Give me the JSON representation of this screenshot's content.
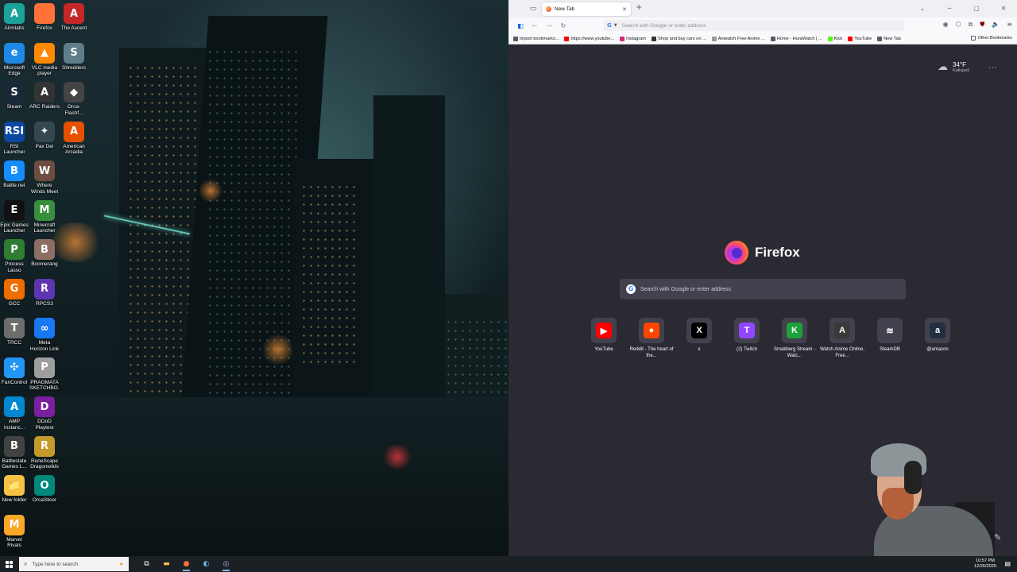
{
  "desktop": {
    "icons": [
      {
        "label": "Airmlabs",
        "glyph": "A",
        "color": "#1aa39a"
      },
      {
        "label": "Firefox",
        "glyph": "",
        "color": "#ff7139"
      },
      {
        "label": "The Ascent",
        "glyph": "A",
        "color": "#c62828"
      },
      {
        "label": "Microsoft Edge",
        "glyph": "e",
        "color": "#1e88e5"
      },
      {
        "label": "VLC media player",
        "glyph": "▲",
        "color": "#ff8800"
      },
      {
        "label": "Shredders",
        "glyph": "S",
        "color": "#607d8b"
      },
      {
        "label": "Steam",
        "glyph": "S",
        "color": "#1b2838"
      },
      {
        "label": "ARC Raiders",
        "glyph": "A",
        "color": "#333333"
      },
      {
        "label": "Orca-Flashf...",
        "glyph": "◆",
        "color": "#444444"
      },
      {
        "label": "RSI Launcher",
        "glyph": "RSI",
        "color": "#0d47a1"
      },
      {
        "label": "Pax Dei",
        "glyph": "✦",
        "color": "#37474f"
      },
      {
        "label": "American Arcadia",
        "glyph": "A",
        "color": "#e65100"
      },
      {
        "label": "Battle.net",
        "glyph": "B",
        "color": "#148eff"
      },
      {
        "label": "Where Winds Meet",
        "glyph": "W",
        "color": "#6d4c41"
      },
      {
        "label": "Epic Games Launcher",
        "glyph": "E",
        "color": "#111111"
      },
      {
        "label": "Minecraft Launcher",
        "glyph": "M",
        "color": "#388e3c"
      },
      {
        "label": "Process Lasso",
        "glyph": "P",
        "color": "#2e7d32"
      },
      {
        "label": "Boomerang",
        "glyph": "B",
        "color": "#8d6e63"
      },
      {
        "label": "GCC",
        "glyph": "G",
        "color": "#ef6c00"
      },
      {
        "label": "RPCS3",
        "glyph": "R",
        "color": "#5e35b1"
      },
      {
        "label": "TRCC",
        "glyph": "T",
        "color": "#6d6d6d"
      },
      {
        "label": "Meta Horizon Link",
        "glyph": "∞",
        "color": "#1877f2"
      },
      {
        "label": "FanControl",
        "glyph": "✣",
        "color": "#2196f3"
      },
      {
        "label": "PRAGMATA SKETCHBO...",
        "glyph": "P",
        "color": "#9e9e9e"
      },
      {
        "label": "AMP Instanc...",
        "glyph": "A",
        "color": "#0288d1"
      },
      {
        "label": "DDoD Playtest",
        "glyph": "D",
        "color": "#7b1fa2"
      },
      {
        "label": "Battlestate Games L...",
        "glyph": "B",
        "color": "#424242"
      },
      {
        "label": "New folder",
        "glyph": "📁",
        "color": "#f6c244"
      },
      {
        "label": "RuneScape Dragonwilds",
        "glyph": "R",
        "color": "#c49a2c"
      },
      {
        "label": "Marvel Rivals",
        "glyph": "M",
        "color": "#f9a825"
      },
      {
        "label": "OrcaSlicer",
        "glyph": "O",
        "color": "#00897b"
      }
    ]
  },
  "browser": {
    "tab_title": "New Tab",
    "url_placeholder": "Search with Google or enter address",
    "bookmarks": [
      {
        "label": "Import bookmarks...",
        "color": "#5b5b66"
      },
      {
        "label": "https://www.youtube...",
        "color": "#ff0000"
      },
      {
        "label": "Instagram",
        "color": "#d62976"
      },
      {
        "label": "Shop and buy cars on ...",
        "color": "#333333"
      },
      {
        "label": "Aniwatch Free Anime ...",
        "color": "#999999"
      },
      {
        "label": "Home - HuraWatch | ...",
        "color": "#5b5b66"
      },
      {
        "label": "Kick",
        "color": "#53fc18"
      },
      {
        "label": "YouTube",
        "color": "#ff0000"
      },
      {
        "label": "New Tab",
        "color": "#5b5b66"
      }
    ],
    "other_bookmarks": "Other Bookmarks",
    "weather": {
      "temp": "34°F",
      "location": "Kalispell"
    },
    "brand": "Firefox",
    "search_placeholder": "Search with Google or enter address",
    "shortcuts": [
      {
        "label": "YouTube",
        "glyph": "▶",
        "color": "#ff0000"
      },
      {
        "label": "Reddit - The heart of the...",
        "glyph": "●",
        "color": "#ff4500"
      },
      {
        "label": "x",
        "glyph": "X",
        "color": "#000000"
      },
      {
        "label": "(2) Twitch",
        "glyph": "T",
        "color": "#9146ff"
      },
      {
        "label": "Smakberg Stream - Watc...",
        "glyph": "K",
        "color": "#1aa33a"
      },
      {
        "label": "Watch Anime Online, Free...",
        "glyph": "A",
        "color": "#3a3a3a"
      },
      {
        "label": "SteamDB",
        "glyph": "≋",
        "color": "#42414d"
      },
      {
        "label": "@amazon",
        "glyph": "a",
        "color": "#232f3e"
      }
    ]
  },
  "taskbar": {
    "search_placeholder": "Type here to search",
    "time": "10:57 PM",
    "date": "12/26/2025"
  }
}
